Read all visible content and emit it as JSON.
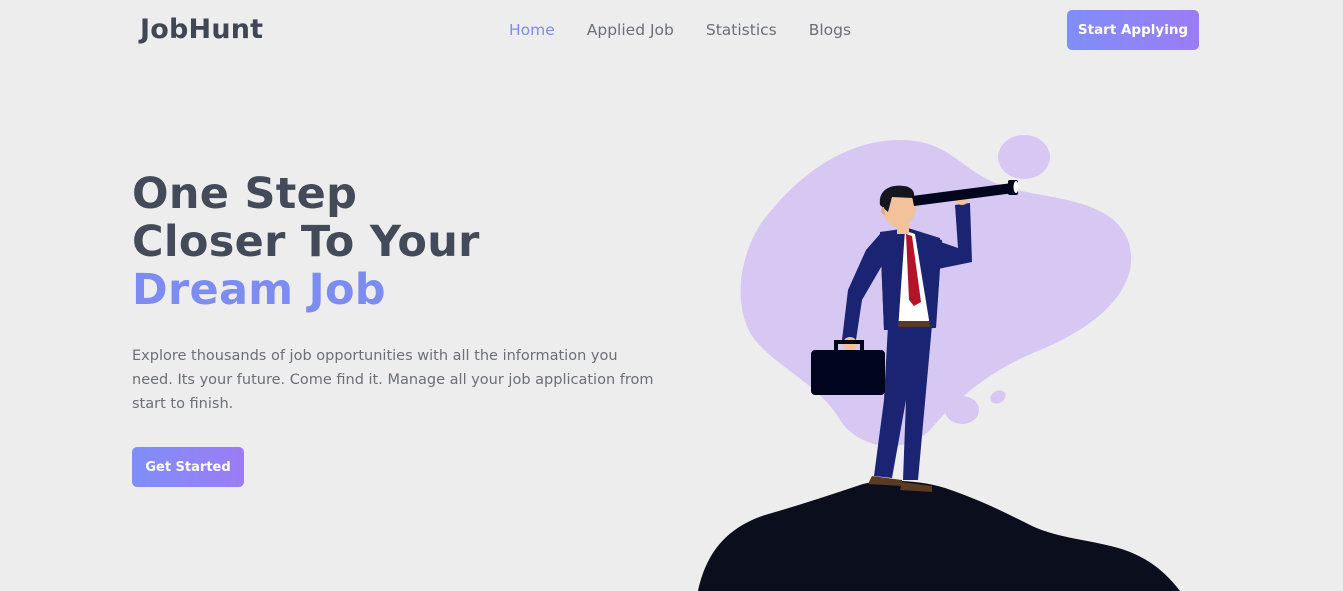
{
  "header": {
    "logo": "JobHunt",
    "nav": [
      {
        "label": "Home",
        "active": true
      },
      {
        "label": "Applied Job",
        "active": false
      },
      {
        "label": "Statistics",
        "active": false
      },
      {
        "label": "Blogs",
        "active": false
      }
    ],
    "cta_label": "Start Applying"
  },
  "hero": {
    "title_line1": "One Step",
    "title_line2": "Closer To Your",
    "title_line3": "Dream Job",
    "description": "Explore thousands of job opportunities with all the information you need. Its your future. Come find it. Manage all your job application from start to finish.",
    "button_label": "Get Started"
  },
  "colors": {
    "accent": "#7c8cf0",
    "gradient_start": "#7f8ef9",
    "gradient_end": "#9c7cf6",
    "heading": "#434b5a",
    "body_text": "#6b6f77",
    "background": "#ededed",
    "blob": "#d6c8f3"
  },
  "icons": {
    "illustration": "man-with-telescope-illustration"
  }
}
